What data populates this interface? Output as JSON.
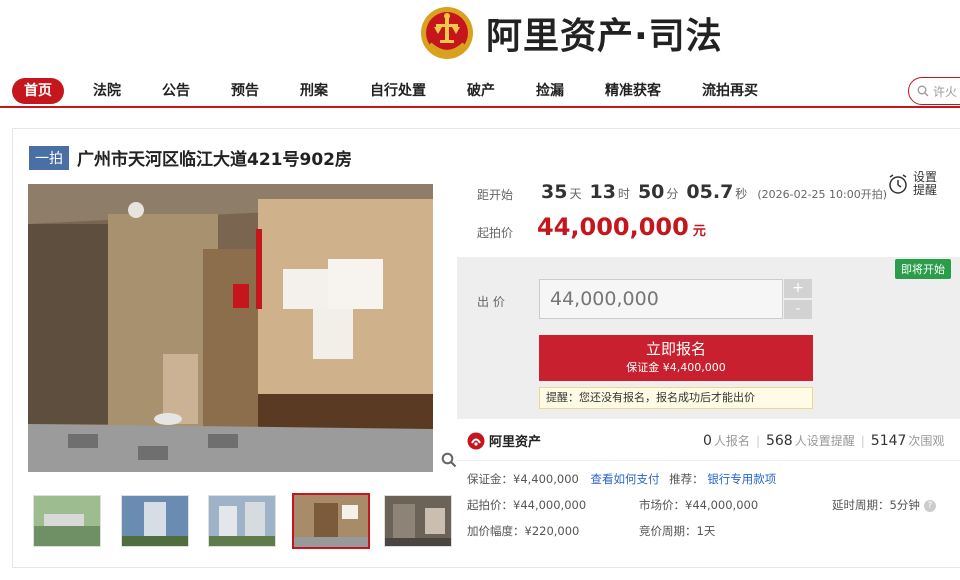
{
  "header": {
    "logo_text": "阿里资产·司法"
  },
  "nav": {
    "items": [
      "首页",
      "法院",
      "公告",
      "预告",
      "刑案",
      "自行处置",
      "破产",
      "捡漏",
      "精准获客",
      "流拍再买"
    ],
    "search_placeholder": "许火"
  },
  "auction": {
    "round_tag": "一拍",
    "title": "广州市天河区临江大道421号902房",
    "countdown": {
      "label": "距开始",
      "days": "35",
      "days_unit": "天",
      "hours": "13",
      "hours_unit": "时",
      "minutes": "50",
      "minutes_unit": "分",
      "seconds": "05.7",
      "seconds_unit": "秒",
      "start_time": "(2026-02-25 10:00开拍)"
    },
    "reminder": {
      "line1": "设置",
      "line2": "提醒"
    },
    "start_price": {
      "label": "起拍价",
      "value": "44,000,000",
      "unit": "元"
    },
    "bid": {
      "status_badge": "即将开始",
      "label": "出 价",
      "input_value": "44,000,000",
      "plus": "+",
      "minus": "-",
      "signup_label": "立即报名",
      "signup_deposit": "保证金 ¥4,400,000",
      "tip": "提醒：您还没有报名，报名成功后才能出价"
    },
    "stats": {
      "platform": "阿里资产",
      "signups": "0",
      "signups_label": "人报名",
      "reminders": "568",
      "reminders_label": "人设置提醒",
      "views": "5147",
      "views_label": "次围观"
    },
    "details": {
      "deposit": "保证金：¥4,400,000",
      "how_to_pay": "查看如何支付",
      "recommend": "推荐：",
      "bank_payment": "银行专用款项",
      "start_price": "起拍价：¥44,000,000",
      "market_price": "市场价：¥44,000,000",
      "delay_period": "延时周期：5分钟",
      "increment": "加价幅度：¥220,000",
      "bid_period": "竞价周期：1天"
    }
  },
  "colors": {
    "brand": "#c4161c",
    "button": "#c8202f",
    "badge_green": "#2a9d4a",
    "link": "#2a67c9"
  }
}
